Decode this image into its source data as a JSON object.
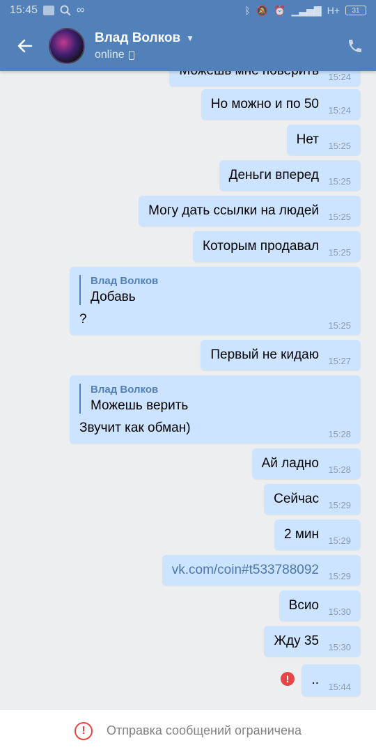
{
  "statusbar": {
    "time": "15:45",
    "network": "H+",
    "battery": "31"
  },
  "header": {
    "title": "Влад Волков",
    "status": "online"
  },
  "messages": [
    {
      "text": "Можешь мне поверить",
      "time": "15:24"
    },
    {
      "text": "Но можно и по 50",
      "time": "15:24"
    },
    {
      "text": "Нет",
      "time": "15:25"
    },
    {
      "text": "Деньги вперед",
      "time": "15:25"
    },
    {
      "text": "Могу дать ссылки на людей",
      "time": "15:25"
    },
    {
      "text": "Которым продавал",
      "time": "15:25"
    },
    {
      "reply_author": "Влад Волков",
      "reply_text": "Добавь",
      "text": "?",
      "time": "15:25"
    },
    {
      "text": "Первый не кидаю",
      "time": "15:27"
    },
    {
      "reply_author": "Влад Волков",
      "reply_text": "Можешь верить",
      "text": "Звучит как обман)",
      "time": "15:28"
    },
    {
      "text": "Ай ладно",
      "time": "15:28"
    },
    {
      "text": "Сейчас",
      "time": "15:29"
    },
    {
      "text": "2 мин",
      "time": "15:29"
    },
    {
      "text": "vk.com/coin#t533788092",
      "time": "15:29"
    },
    {
      "text": "Всио",
      "time": "15:30"
    },
    {
      "text": "Жду 35",
      "time": "15:30"
    },
    {
      "text": "..",
      "time": "15:44"
    }
  ],
  "footer": {
    "text": "Отправка сообщений ограничена"
  },
  "icons": {
    "back": "arrow-left-icon",
    "call": "phone-icon",
    "error": "error-icon"
  },
  "colors": {
    "header_bg": "#5181b8",
    "bubble_bg": "#cce4ff",
    "chat_bg": "#edeef0",
    "error": "#e64646",
    "link": "#4a76a8"
  }
}
